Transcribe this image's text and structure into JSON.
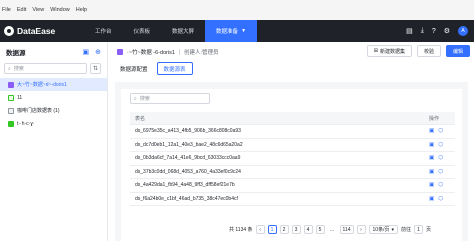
{
  "menubar": {
    "items": [
      "File",
      "Edit",
      "View",
      "Window",
      "Help"
    ]
  },
  "topbar": {
    "app_name": "DataEase",
    "tabs": [
      {
        "label": "工作台",
        "active": false
      },
      {
        "label": "仪表板",
        "active": false
      },
      {
        "label": "数据大屏",
        "active": false
      },
      {
        "label": "数据准备",
        "active": true
      }
    ],
    "icons": [
      "calendar-icon",
      "download-icon",
      "help-icon",
      "settings-icon"
    ],
    "avatar": "A"
  },
  "sidebar": {
    "title": "数据源",
    "search_placeholder": "搜索",
    "items": [
      {
        "label": "大~竹~数据~d~-doris1",
        "selected": true,
        "icon": "datasource-icon"
      },
      {
        "label": "11",
        "selected": false,
        "icon": "file-icon"
      },
      {
        "label": "咖啡门店数据表 (1)",
        "selected": false,
        "icon": "file-icon"
      },
      {
        "label": "t··h·c·ɣ·",
        "selected": false,
        "icon": "datasource-icon"
      }
    ]
  },
  "main": {
    "crumb_title": "·~竹~数据 -6-doris1",
    "crumb_creator": "创建人:管理员",
    "buttons": {
      "new_dataset": "新建数据集",
      "validate": "校验",
      "edit": "编辑"
    },
    "subtabs": [
      {
        "label": "数据源配置",
        "active": false
      },
      {
        "label": "数据源表",
        "active": true
      }
    ],
    "table": {
      "search_placeholder": "搜索",
      "headers": {
        "name": "表名",
        "action": "操作"
      },
      "rows": [
        "ds_6975e35c_a413_4fb5_906b_366c808c0a93",
        "ds_dc7d0eb1_12a1_40e3_bae2_48c6d65a20a2",
        "ds_0b3da6cf_7a14_41e6_9bcd_63033ccc0aa9",
        "ds_37b3c0dd_068d_4053_a760_4a33ef0c9c24",
        "ds_4a429da1_fb94_4a48_9ff3_dff58ef21e7b",
        "ds_f6a24b0e_c1bf_46ad_b735_38c47ec0b4cf"
      ]
    },
    "pager": {
      "total": "共 1134 条",
      "pages": [
        "1",
        "2",
        "3",
        "4",
        "5",
        "...",
        "114"
      ],
      "current": "1",
      "page_size": "10条/页",
      "goto_label": "前往",
      "goto_value": "1",
      "page_suffix": "页"
    }
  }
}
